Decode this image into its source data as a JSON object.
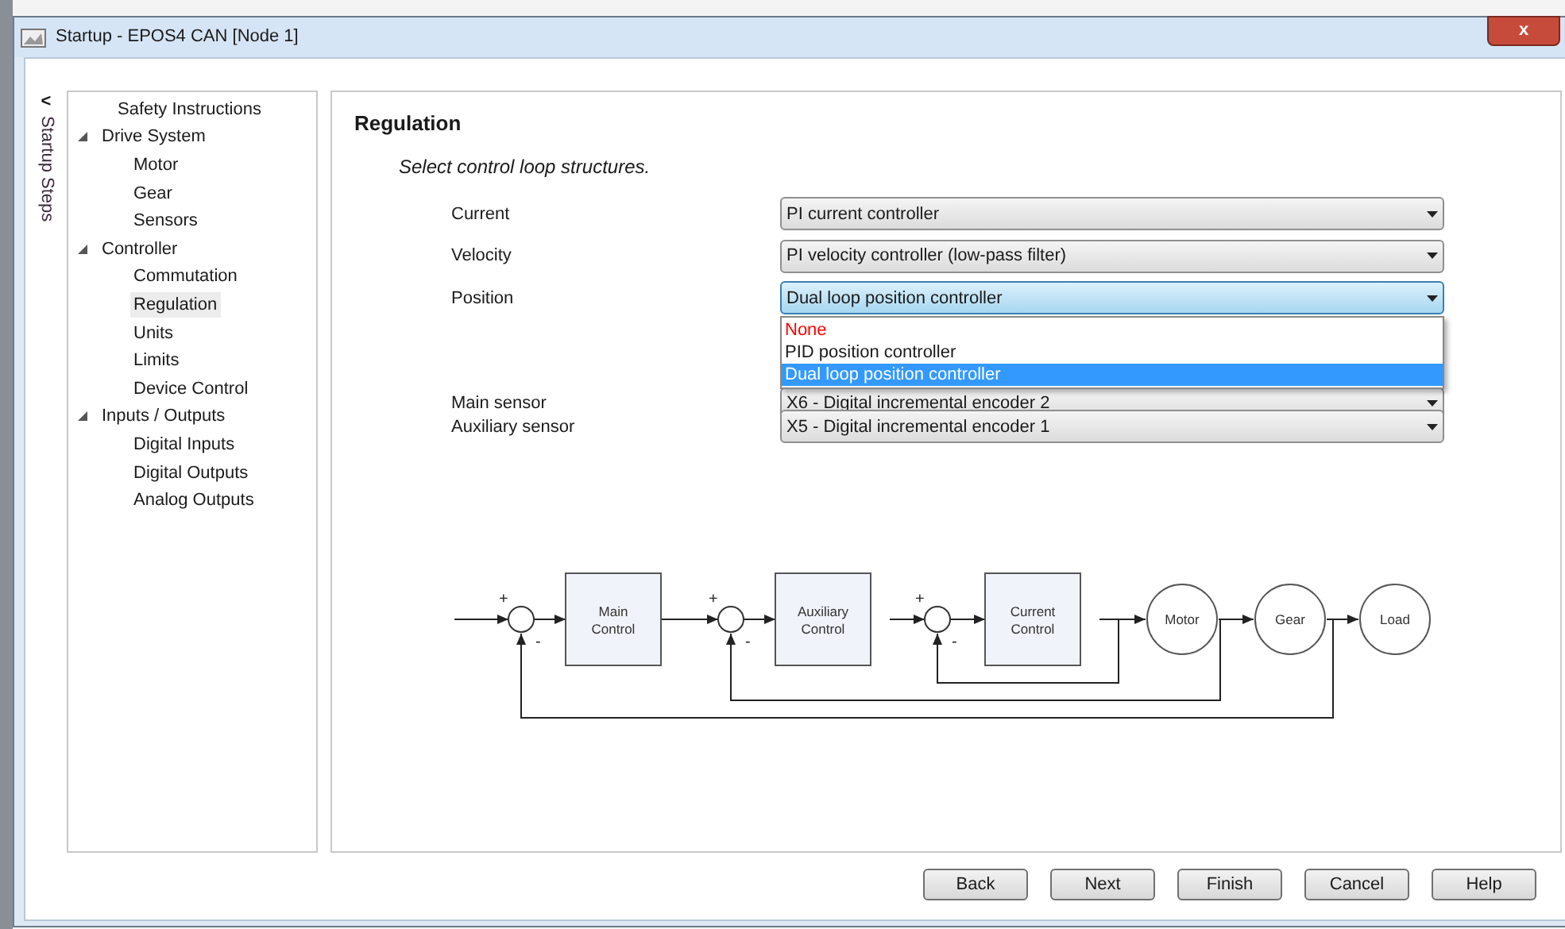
{
  "window": {
    "title": "Startup - EPOS4 CAN [Node 1]",
    "close": "x"
  },
  "side_tab": {
    "arrow": "<",
    "label": "Startup Steps"
  },
  "tree": [
    {
      "label": "Safety Instructions",
      "selected": false
    },
    {
      "label": "Drive System",
      "expanded": true,
      "selected": false,
      "children": [
        {
          "label": "Motor",
          "selected": false
        },
        {
          "label": "Gear",
          "selected": false
        },
        {
          "label": "Sensors",
          "selected": false
        }
      ]
    },
    {
      "label": "Controller",
      "expanded": true,
      "selected": false,
      "children": [
        {
          "label": "Commutation",
          "selected": false
        },
        {
          "label": "Regulation",
          "selected": true
        },
        {
          "label": "Units",
          "selected": false
        },
        {
          "label": "Limits",
          "selected": false
        },
        {
          "label": "Device Control",
          "selected": false
        }
      ]
    },
    {
      "label": "Inputs / Outputs",
      "expanded": true,
      "selected": false,
      "children": [
        {
          "label": "Digital Inputs",
          "selected": false
        },
        {
          "label": "Digital Outputs",
          "selected": false
        },
        {
          "label": "Analog Outputs",
          "selected": false
        }
      ]
    }
  ],
  "page": {
    "title": "Regulation",
    "instruction": "Select control loop structures.",
    "fields": [
      {
        "label": "Current",
        "value": "PI current controller",
        "open": false
      },
      {
        "label": "Velocity",
        "value": "PI velocity controller (low-pass filter)",
        "open": false
      },
      {
        "label": "Position",
        "value": "Dual loop position controller",
        "open": true,
        "options": [
          {
            "label": "None",
            "selected": false,
            "color": "#ff0000"
          },
          {
            "label": "PID position controller",
            "selected": false
          },
          {
            "label": "Dual loop position controller",
            "selected": true
          }
        ]
      },
      {
        "label": "Main sensor",
        "value": "X6 - Digital incremental encoder 2",
        "open": false
      },
      {
        "label": "Auxiliary sensor",
        "value": "X5 - Digital incremental encoder 1",
        "open": false
      }
    ],
    "diagram": {
      "controllers": [
        {
          "label": "Main Control"
        },
        {
          "label": "Auxiliary Control"
        },
        {
          "label": "Current Control"
        }
      ],
      "sums": [
        {
          "plus": "+",
          "minus": "-"
        },
        {
          "plus": "+",
          "minus": "-"
        },
        {
          "plus": "+",
          "minus": "-"
        }
      ],
      "plants": [
        {
          "label": "Motor"
        },
        {
          "label": "Gear"
        },
        {
          "label": "Load"
        }
      ]
    }
  },
  "buttons": [
    "Back",
    "Next",
    "Finish",
    "Cancel",
    "Help"
  ]
}
